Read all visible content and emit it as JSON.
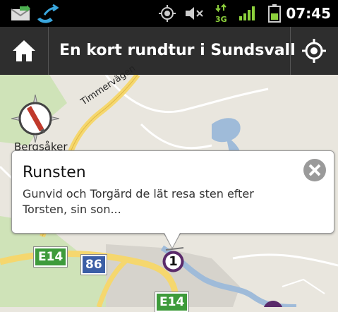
{
  "status_bar": {
    "time": "07:45",
    "icons": [
      "mail-icon",
      "missed-call-icon",
      "gps-icon",
      "mute-icon",
      "3g-icon",
      "signal-icon",
      "battery-icon"
    ]
  },
  "title_bar": {
    "title": "En kort rundtur i Sundsvall",
    "home_icon": "home-icon",
    "locate_icon": "locate-icon"
  },
  "map": {
    "place_label": "Bergsåker",
    "road_label": "Timmervägen",
    "route_shields": [
      {
        "label": "E14",
        "color": "#3e9b3b"
      },
      {
        "label": "86",
        "color": "#3b5ea6"
      },
      {
        "label": "E14",
        "color": "#3e9b3b"
      }
    ],
    "marker_number": "1",
    "marker_color": "#5a2a6a"
  },
  "popup": {
    "title": "Runsten",
    "text": "Gunvid och Torgärd de lät resa sten efter Torsten, sin son...",
    "close_icon": "close-icon"
  }
}
